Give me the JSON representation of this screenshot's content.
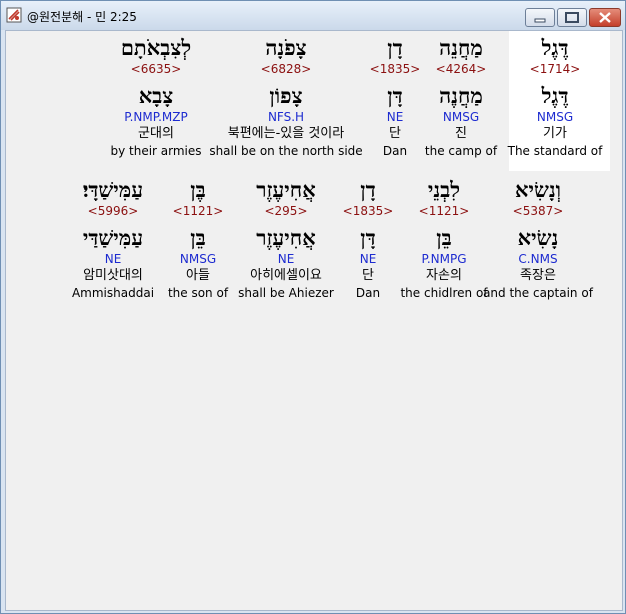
{
  "window": {
    "title": "@원전분해 - 민 2:25",
    "buttons": {
      "minimize": "minimize-icon",
      "maximize": "maximize-icon",
      "close": "close-icon"
    }
  },
  "colors": {
    "strong": "#8b1010",
    "morph": "#1d2bd0",
    "highlight": "#ffffff"
  },
  "rows": [
    {
      "words": [
        {
          "hebrew": "דֶּגֶל",
          "strong": "<1714>",
          "lemma": "דֶּגֶל",
          "morph": "NMSG",
          "korean": "기가",
          "english": "The standard of",
          "highlighted": true
        },
        {
          "hebrew": "מַחֲנֵה",
          "strong": "<4264>",
          "lemma": "מַחֲנֶה",
          "morph": "NMSG",
          "korean": "진",
          "english": "the camp of"
        },
        {
          "hebrew": "דָן",
          "strong": "<1835>",
          "lemma": "דָּן",
          "morph": "NE",
          "korean": "단",
          "english": "Dan"
        },
        {
          "hebrew": "צָפֹנָה",
          "strong": "<6828>",
          "lemma": "צָפוֹן",
          "morph": "NFS.H",
          "korean": "북편에는-있을 것이라",
          "english": "shall be on the north side"
        },
        {
          "hebrew": "לְצִבְאֹתָם",
          "strong": "<6635>",
          "lemma": "צָבָא",
          "morph": "P.NMP.MZP",
          "korean": "군대의",
          "english": "by their armies"
        }
      ]
    },
    {
      "words": [
        {
          "hebrew": "וְנָשִׂיא",
          "strong": "<5387>",
          "lemma": "נָשִׂיא",
          "morph": "C.NMS",
          "korean": "족장은",
          "english": "and the captain of"
        },
        {
          "hebrew": "לִבְנֵי",
          "strong": "<1121>",
          "lemma": "בֵּן",
          "morph": "P.NMPG",
          "korean": "자손의",
          "english": "the chidlren of"
        },
        {
          "hebrew": "דָן",
          "strong": "<1835>",
          "lemma": "דָּן",
          "morph": "NE",
          "korean": "단",
          "english": "Dan"
        },
        {
          "hebrew": "אֲחִיעֶזֶר",
          "strong": "<295>",
          "lemma": "אֲחִיעֶזֶר",
          "morph": "NE",
          "korean": "아히에셀이요",
          "english": "shall be Ahiezer"
        },
        {
          "hebrew": "בֶּן",
          "strong": "<1121>",
          "lemma": "בֵּן",
          "morph": "NMSG",
          "korean": "아들",
          "english": "the son of"
        },
        {
          "hebrew": "עַמִּישַׁדָּי׃",
          "strong": "<5996>",
          "lemma": "עַמִּישַׁדַּי",
          "morph": "NE",
          "korean": "암미삿대의",
          "english": "Ammishaddai"
        }
      ]
    }
  ]
}
